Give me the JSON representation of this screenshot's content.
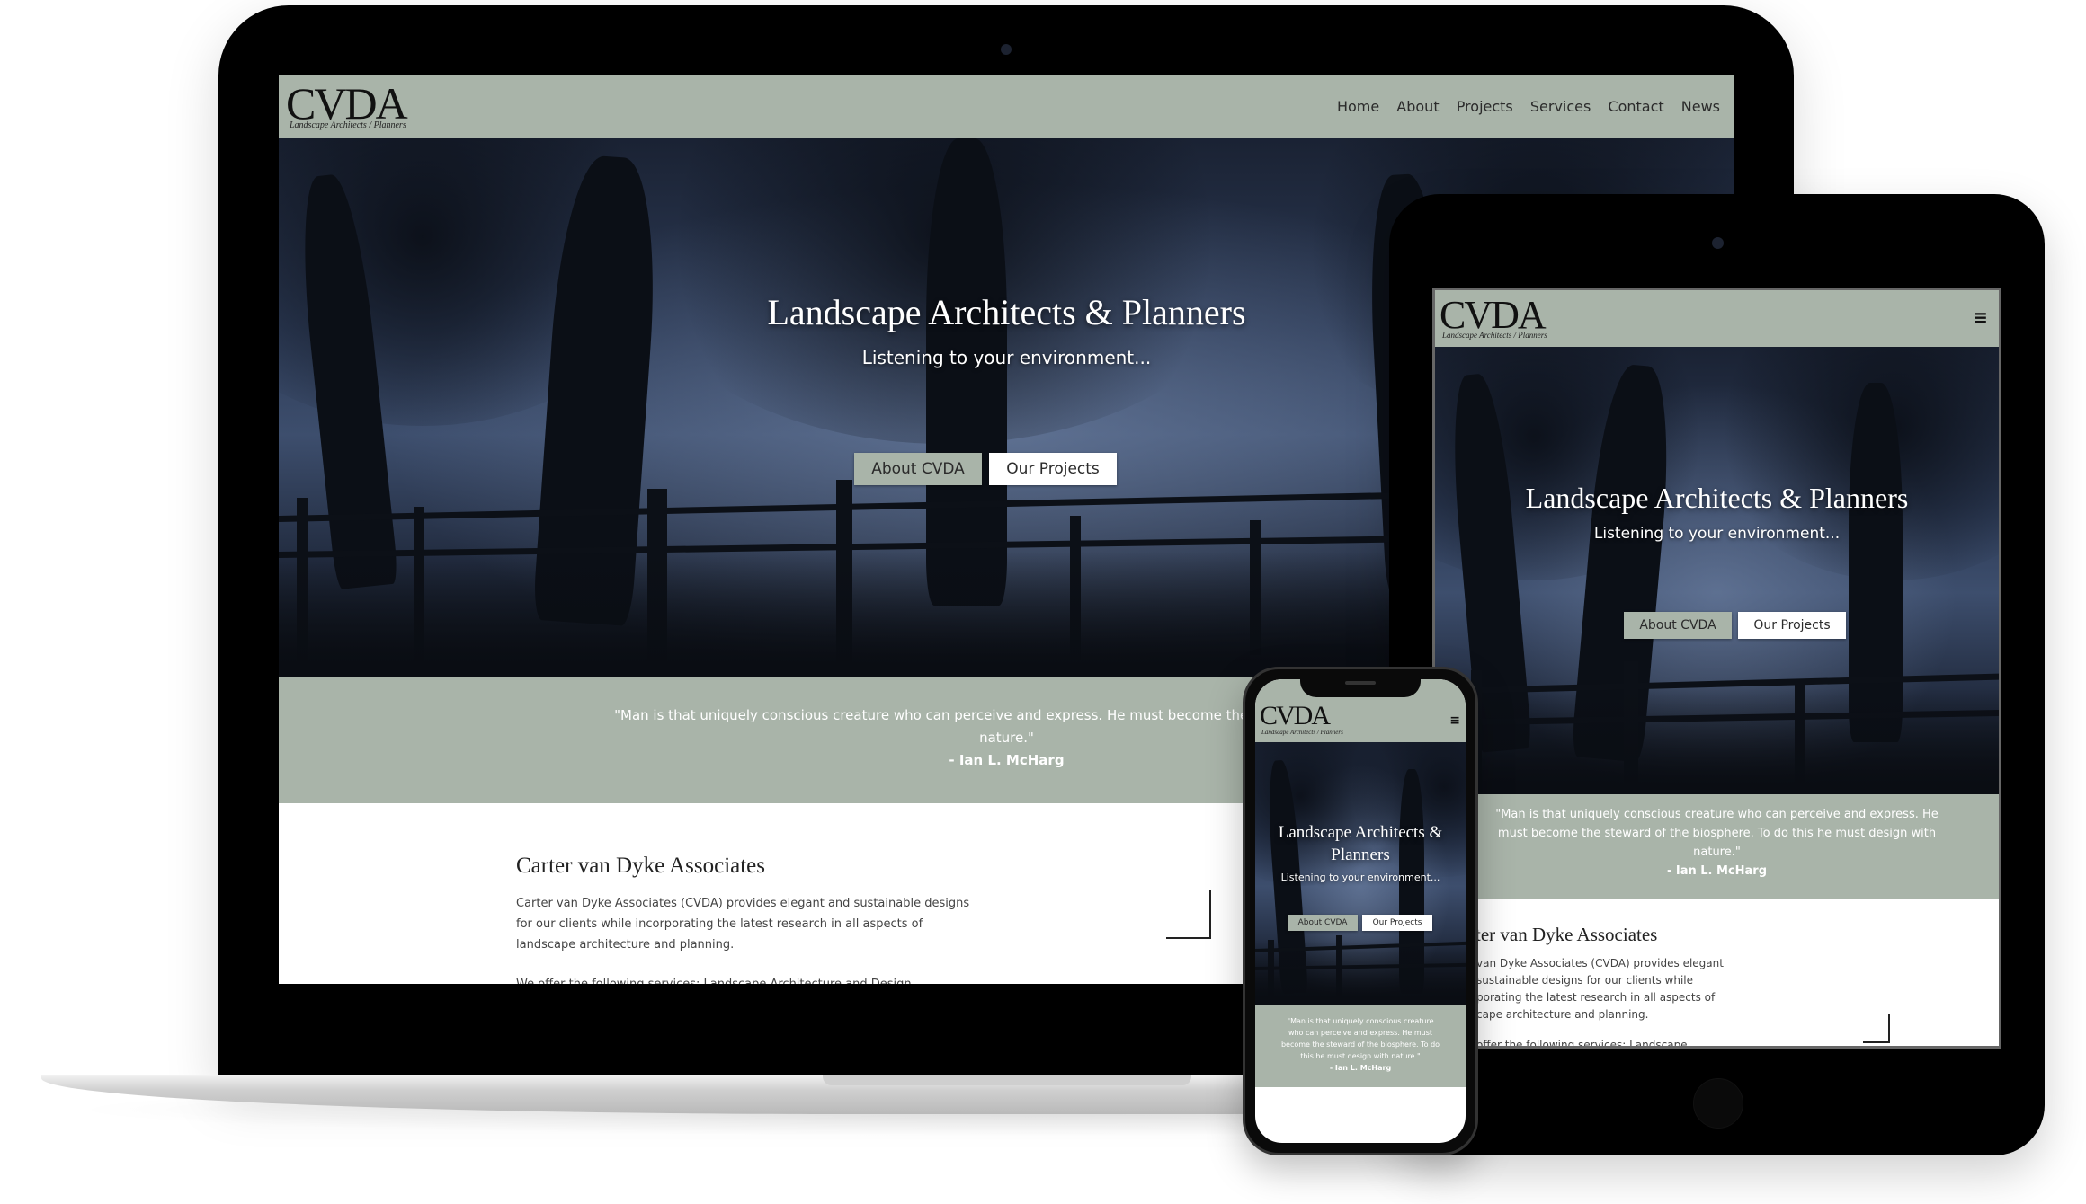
{
  "brand": {
    "logo": "CVDA",
    "tagline": "Landscape Architects / Planners"
  },
  "nav": {
    "items": [
      "Home",
      "About",
      "Projects",
      "Services",
      "Contact",
      "News"
    ],
    "menu_icon": "hamburger-icon"
  },
  "hero": {
    "title": "Landscape Architects & Planners",
    "subtitle": "Listening to your environment...",
    "btn_about": "About CVDA",
    "btn_projects": "Our Projects"
  },
  "quote": {
    "laptop_line1": "\"Man is that uniquely conscious creature who can perceive and express. He must become the steward of the biosph",
    "laptop_line2": "nature.\"",
    "tablet_line1": "\"Man is that uniquely conscious creature who can perceive and express. He",
    "tablet_line2": "must become the steward of the biosphere. To do this he must design with",
    "tablet_line3": "nature.\"",
    "phone_line1": "\"Man is that uniquely conscious creature",
    "phone_line2": "who can perceive and express. He must",
    "phone_line3": "become the steward of the biosphere. To do",
    "phone_line4": "this he must design with nature.\"",
    "author": "- Ian L. McHarg"
  },
  "about": {
    "title": "Carter van Dyke Associates",
    "title_partial": "rter van Dyke Associates",
    "laptop_line1": "Carter van Dyke Associates (CVDA) provides elegant and sustainable designs",
    "laptop_line2": "for our clients while incorporating the latest research in all aspects of",
    "laptop_line3": "landscape architecture and planning.",
    "laptop_line4": "We offer the following services: Landscape Architecture and Design",
    "tablet_line1": "van Dyke Associates (CVDA) provides elegant",
    "tablet_line2": "sustainable designs for our clients while",
    "tablet_line3": "porating the latest research in all aspects of",
    "tablet_line4": "cape architecture and planning.",
    "tablet_line5": "offer the following services: Landscape"
  },
  "colors": {
    "sage": "#a9b4a9",
    "device": "#000000",
    "hero_dark": "#1a2233"
  }
}
